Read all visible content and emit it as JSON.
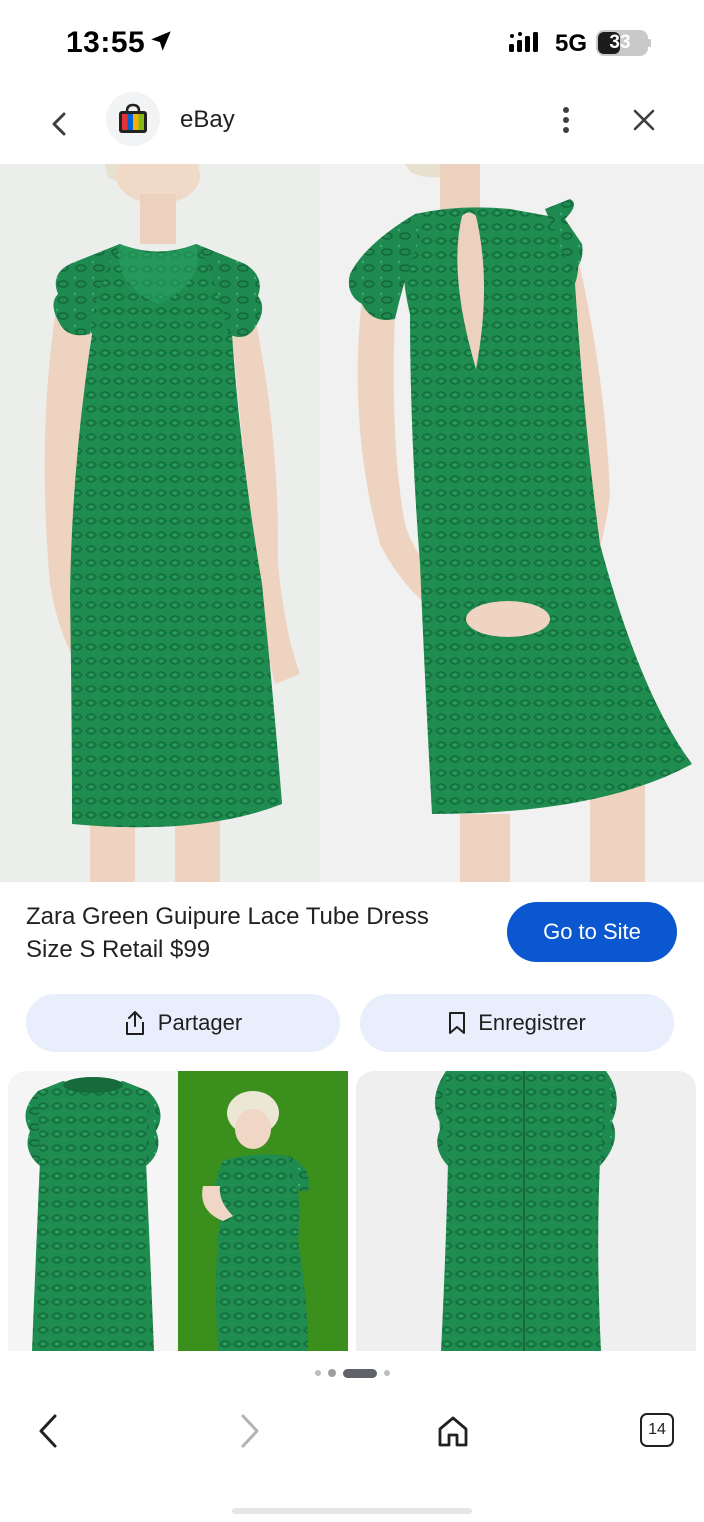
{
  "status_bar": {
    "time": "13:55",
    "network": "5G",
    "battery": "33"
  },
  "header": {
    "site_name": "eBay",
    "icons": [
      "back-arrow-icon",
      "ebay-bag-logo",
      "more-vert-icon",
      "close-icon"
    ]
  },
  "product": {
    "title": "Zara Green Guipure Lace Tube Dress Size S Retail $99",
    "go_to_site_label": "Go to Site"
  },
  "actions": {
    "share_label": "Partager",
    "save_label": "Enregistrer"
  },
  "bottom_nav": {
    "tab_count": "14"
  },
  "colors": {
    "accent": "#0b57d0",
    "chip_bg": "#e8eefb",
    "dress_green": "#1e8f52"
  }
}
